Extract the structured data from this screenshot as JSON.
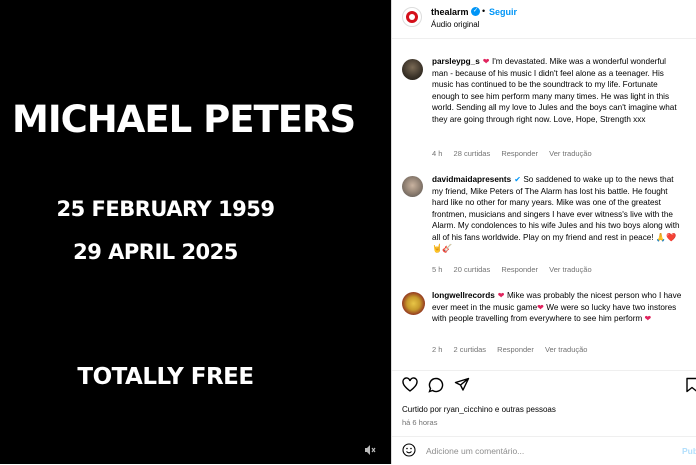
{
  "media": {
    "name": "MICHAEL PETERS",
    "birth": "25 FEBRUARY 1959",
    "death": "29 APRIL 2025",
    "tagline": "TOTALLY FREE",
    "audio_icon": "speaker-muted-icon"
  },
  "header": {
    "username": "thealarm",
    "separator": "•",
    "follow_label": "Seguir",
    "audio": "Áudio original"
  },
  "comments": [
    {
      "user": "parsleypg_s",
      "text": "I'm devastated. Mike was a wonderful wonderful man - because of his music I didn't feel alone as a teenager. His music has continued to be the soundtrack to my life. Fortunate enough to see him perform many many times. He was light in this world. Sending all my love to Jules and the boys can't imagine what they are going through right now. Love, Hope, Strength xxx",
      "age": "4 h",
      "likes": "28 curtidas",
      "reply": "Responder",
      "translate": "Ver tradução"
    },
    {
      "user": "davidmaidapresents",
      "text": "So saddened to wake up to the news that my friend, Mike Peters of The Alarm has lost his battle. He fought hard like no other for many years. Mike was one of the greatest frontmen, musicians and singers I have ever witness's live with the Alarm. My condolences to his wife Jules and his two boys along with all of his fans worldwide. Play on my friend and rest in peace!",
      "emoji_tail": "🙏❤️🤘🎸",
      "age": "5 h",
      "likes": "20 curtidas",
      "reply": "Responder",
      "translate": "Ver tradução"
    },
    {
      "user": "longwellrecords",
      "text": "Mike was probably the nicest person who I have ever meet in the music game",
      "text2": "We were so lucky have two instores with people travelling from everywhere to see him perform",
      "age": "2 h",
      "likes": "2 curtidas",
      "reply": "Responder",
      "translate": "Ver tradução"
    }
  ],
  "liked_by": "Curtido por ryan_cicchino e outras pessoas",
  "post_age": "há 6 horas",
  "comment_placeholder": "Adicione um comentário...",
  "post_label": "Publicar",
  "colors": {
    "accent": "#0095f6",
    "heart": "#e0245e",
    "brand": "#d40f1a"
  }
}
